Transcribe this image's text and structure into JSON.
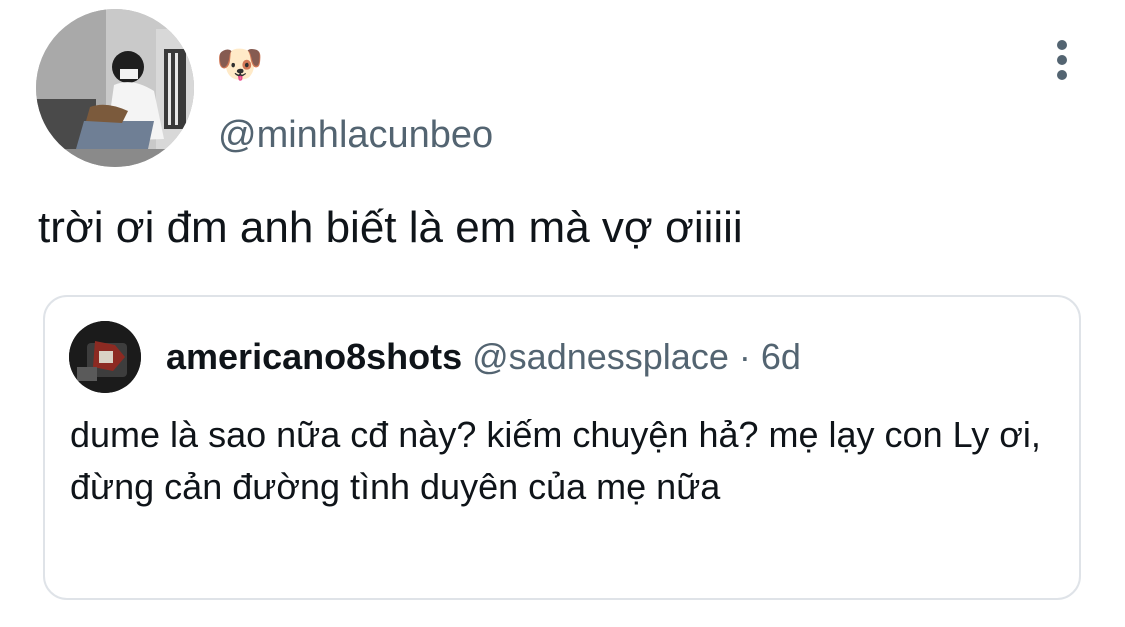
{
  "tweet": {
    "author": {
      "display_name": "🐶",
      "handle": "@minhlacunbeo"
    },
    "text": "trời ơi đm anh biết là em mà vợ ơiiiii",
    "menu_icon": "more-vertical-icon"
  },
  "quoted_tweet": {
    "author_name": "americano8shots",
    "handle": "@sadnessplace",
    "separator": "·",
    "time": "6d",
    "text": "dume là sao nữa cđ này? kiếm chuyện hả? mẹ lạy con Ly ơi, đừng cản đường tình duyên của mẹ nữa"
  },
  "colors": {
    "text_primary": "#0f1419",
    "text_secondary": "#536471",
    "border": "#dfe3e8"
  }
}
